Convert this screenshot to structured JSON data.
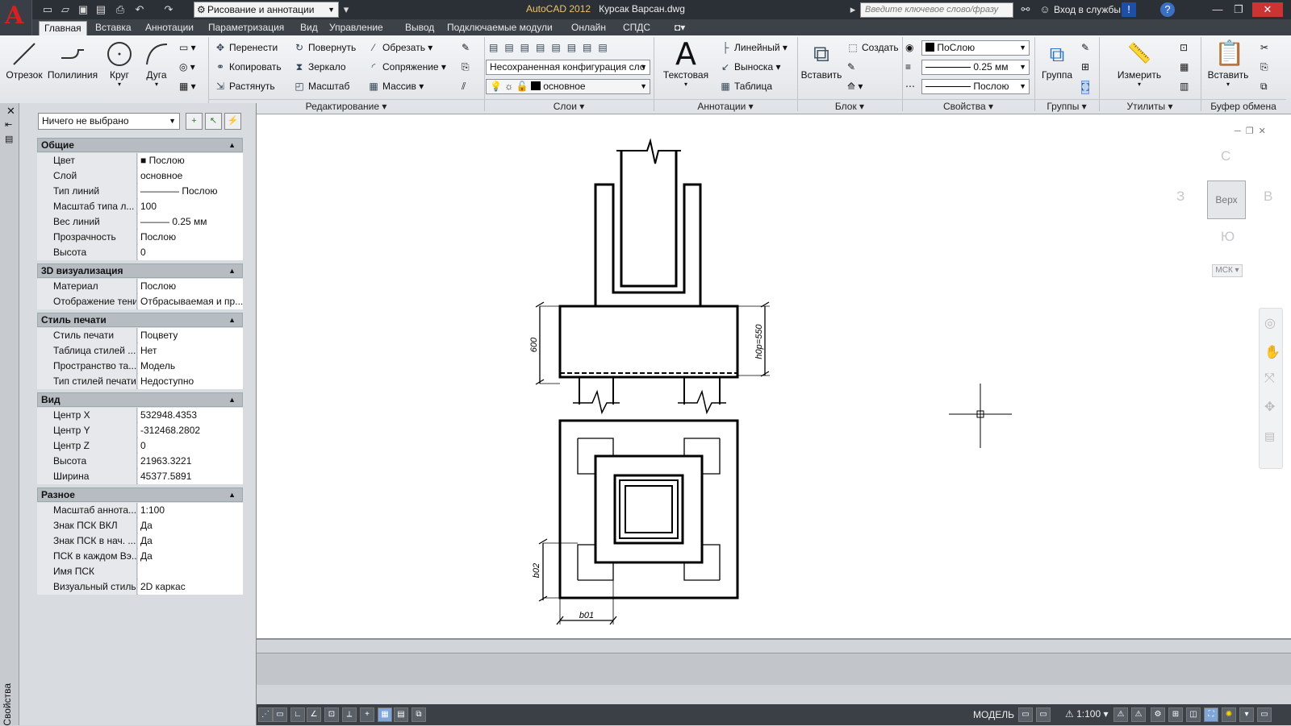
{
  "title": {
    "app": "AutoCAD 2012",
    "doc": "Курсак Варсан.dwg",
    "workspace": "Рисование и аннотации",
    "search_placeholder": "Введите ключевое слово/фразу",
    "signin": "Вход в службы"
  },
  "tabs": [
    "Главная",
    "Вставка",
    "Аннотации",
    "Параметризация",
    "Вид",
    "Управление",
    "Вывод",
    "Подключаемые модули",
    "Онлайн",
    "СПДС"
  ],
  "ribbon": {
    "draw": {
      "line": "Отрезок",
      "polyline": "Полилиния",
      "circle": "Круг",
      "arc": "Дуга"
    },
    "modify": {
      "label": "Редактирование",
      "move": "Перенести",
      "copy": "Копировать",
      "stretch": "Растянуть",
      "rotate": "Повернуть",
      "mirror": "Зеркало",
      "scale": "Масштаб",
      "trim": "Обрезать",
      "fillet": "Сопряжение",
      "array": "Массив"
    },
    "layers": {
      "label": "Слои",
      "state": "Несохраненная конфигурация сло",
      "current": "основное"
    },
    "annot": {
      "label": "Аннотации",
      "text": "Текстовая",
      "linear": "Линейный",
      "leader": "Выноска",
      "table": "Таблица"
    },
    "block": {
      "label": "Блок",
      "insert": "Вставить",
      "create": "Создать"
    },
    "props": {
      "label": "Свойства",
      "color": "ПоСлою",
      "lineweight": "0.25 мм",
      "linetype": "Послою"
    },
    "groups": {
      "label": "Группы",
      "group": "Группа"
    },
    "utils": {
      "label": "Утилиты",
      "measure": "Измерить"
    },
    "clip": {
      "label": "Буфер обмена",
      "paste": "Вставить"
    }
  },
  "palette": {
    "selection": "Ничего не выбрано",
    "general": {
      "title": "Общие",
      "rows": [
        [
          "Цвет",
          "■ Послою"
        ],
        [
          "Слой",
          "основное"
        ],
        [
          "Тип линий",
          "———— Послою"
        ],
        [
          "Масштаб типа л...",
          "100"
        ],
        [
          "Вес линий",
          "——— 0.25 мм"
        ],
        [
          "Прозрачность",
          "Послою"
        ],
        [
          "Высота",
          "0"
        ]
      ]
    },
    "viz": {
      "title": "3D визуализация",
      "rows": [
        [
          "Материал",
          "Послою"
        ],
        [
          "Отображение тени",
          "Отбрасываемая и пр..."
        ]
      ]
    },
    "plot": {
      "title": "Стиль печати",
      "rows": [
        [
          "Стиль печати",
          "Поцвету"
        ],
        [
          "Таблица стилей ...",
          "Нет"
        ],
        [
          "Пространство та...",
          "Модель"
        ],
        [
          "Тип стилей печати",
          "Недоступно"
        ]
      ]
    },
    "view": {
      "title": "Вид",
      "rows": [
        [
          "Центр X",
          "532948.4353"
        ],
        [
          "Центр Y",
          "-312468.2802"
        ],
        [
          "Центр Z",
          "0"
        ],
        [
          "Высота",
          "21963.3221"
        ],
        [
          "Ширина",
          "45377.5891"
        ]
      ]
    },
    "misc": {
      "title": "Разное",
      "rows": [
        [
          "Масштаб аннота...",
          "1:100"
        ],
        [
          "Знак ПСК ВКЛ",
          "Да"
        ],
        [
          "Знак ПСК в нач. ...",
          "Да"
        ],
        [
          "ПСК в каждом Вэ...",
          "Да"
        ],
        [
          "Имя ПСК",
          ""
        ],
        [
          "Визуальный стиль",
          "2D каркас"
        ]
      ]
    },
    "side_label": "Свойства"
  },
  "drawing": {
    "dim600": "600",
    "dimh0p": "h0p=550",
    "dimb02": "b02",
    "dimb01": "b01"
  },
  "viewcube": {
    "top": "Верх",
    "n": "С",
    "s": "Ю",
    "w": "З",
    "e": "В",
    "ucs": "МСК"
  },
  "status": {
    "model": "МОДЕЛЬ",
    "scale": "1:100"
  }
}
